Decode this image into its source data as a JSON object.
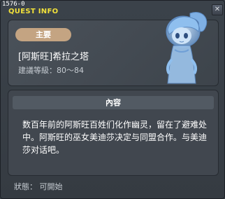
{
  "window": {
    "quest_id": "1576-0",
    "title": "QUEST INFO",
    "close_label": "✕"
  },
  "quest": {
    "category": "主要",
    "name": "[阿斯旺]希拉之塔",
    "level_label": "建議等級：",
    "level_range": "80～84"
  },
  "content": {
    "header": "內容",
    "text": "数百年前的阿斯旺百姓们化作幽灵，留在了避难处中。阿斯旺的巫女美迪莎决定与同盟合作。与美迪莎对话吧。"
  },
  "status": {
    "label": "狀態：",
    "value": "可開始"
  },
  "icons": {
    "npc": "npc-medusa-portrait"
  },
  "colors": {
    "title_accent": "#f2e23a",
    "badge": "#c4a482",
    "npc_tint": "#8fb9e6"
  }
}
